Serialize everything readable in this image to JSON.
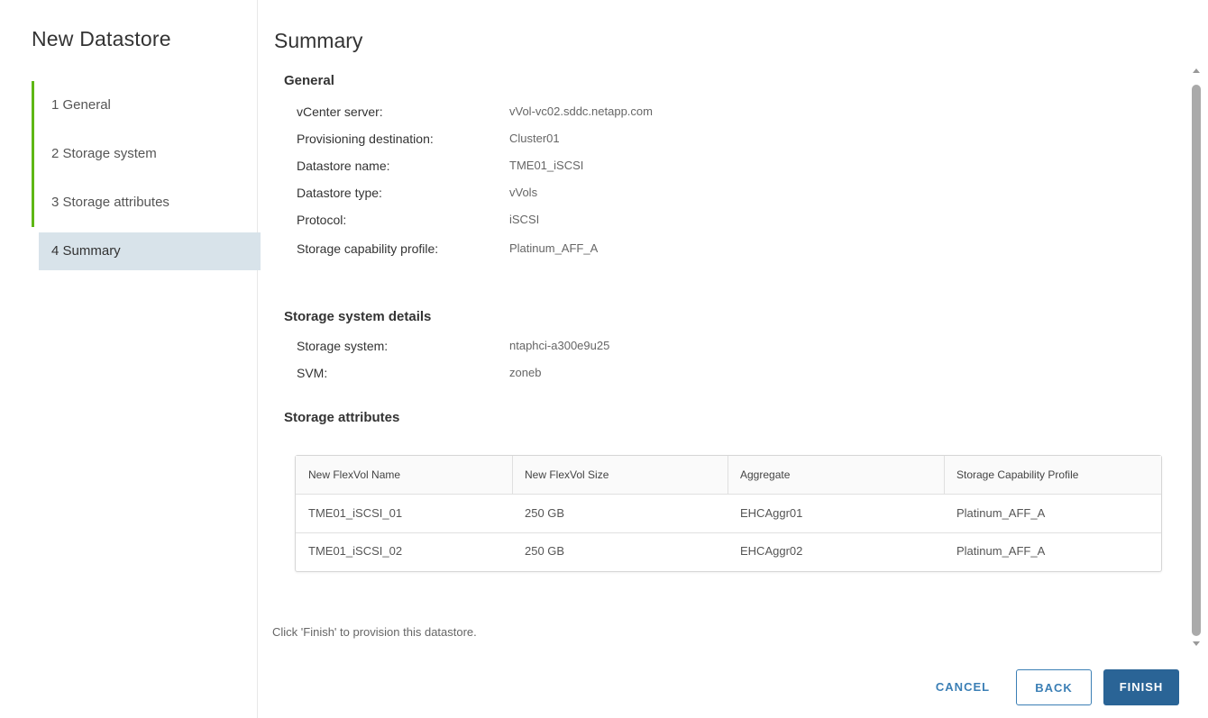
{
  "wizard": {
    "title": "New Datastore",
    "steps": [
      {
        "label": "1 General"
      },
      {
        "label": "2 Storage system"
      },
      {
        "label": "3 Storage attributes"
      },
      {
        "label": "4 Summary"
      }
    ],
    "active_step": 4
  },
  "page": {
    "title": "Summary"
  },
  "general": {
    "heading": "General",
    "rows": [
      {
        "key": "vCenter server:",
        "value": "vVol-vc02.sddc.netapp.com"
      },
      {
        "key": "Provisioning destination:",
        "value": "Cluster01"
      },
      {
        "key": "Datastore name:",
        "value": "TME01_iSCSI"
      },
      {
        "key": "Datastore type:",
        "value": "vVols"
      },
      {
        "key": "Protocol:",
        "value": "iSCSI"
      },
      {
        "key": "Storage capability profile:",
        "value": "Platinum_AFF_A"
      }
    ]
  },
  "storage_system": {
    "heading": "Storage system details",
    "rows": [
      {
        "key": "Storage system:",
        "value": "ntaphci-a300e9u25"
      },
      {
        "key": "SVM:",
        "value": "zoneb"
      }
    ]
  },
  "storage_attributes": {
    "heading": "Storage attributes",
    "columns": [
      "New FlexVol Name",
      "New FlexVol Size",
      "Aggregate",
      "Storage Capability Profile"
    ],
    "rows": [
      [
        "TME01_iSCSI_01",
        "250 GB",
        "EHCAggr01",
        "Platinum_AFF_A"
      ],
      [
        "TME01_iSCSI_02",
        "250 GB",
        "EHCAggr02",
        "Platinum_AFF_A"
      ]
    ]
  },
  "hint": "Click 'Finish' to provision this datastore.",
  "buttons": {
    "cancel": "CANCEL",
    "back": "BACK",
    "finish": "FINISH"
  },
  "colors": {
    "accent": "#2a6496",
    "step_done": "#5eb715",
    "active_step_bg": "#d8e3ea"
  }
}
